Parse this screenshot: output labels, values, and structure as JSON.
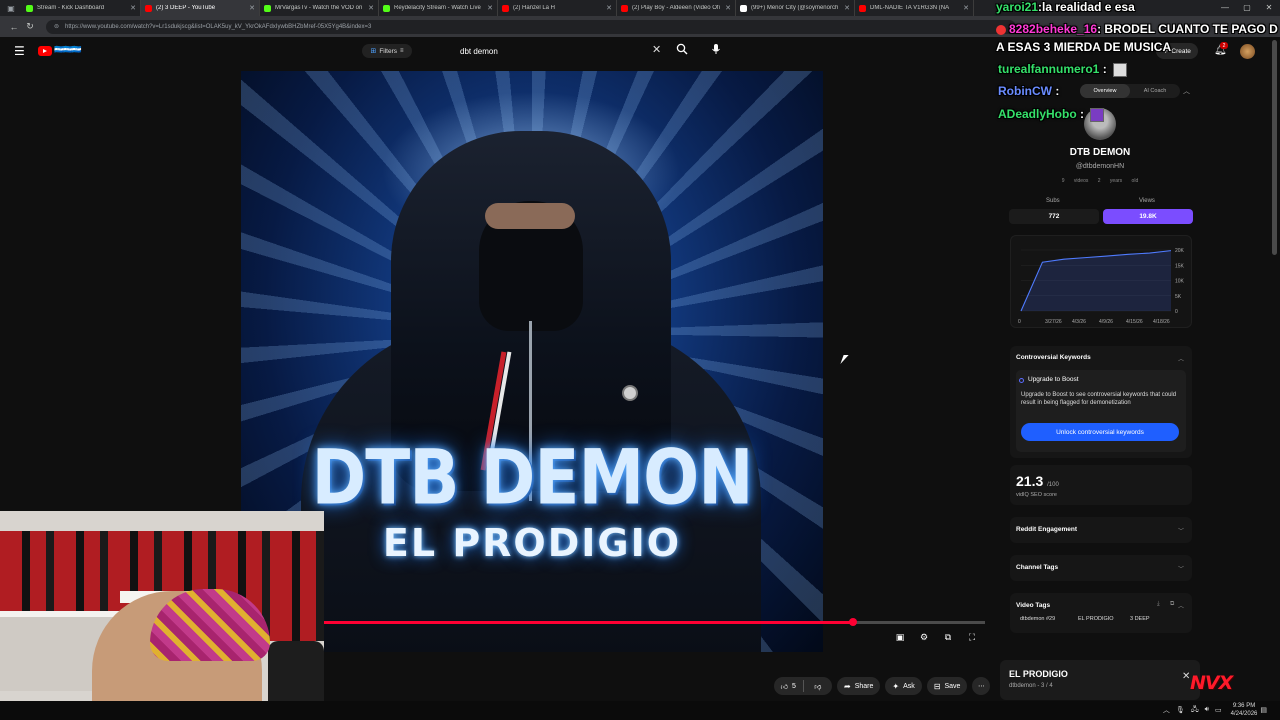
{
  "browser": {
    "tabs": [
      {
        "title": "Stream - Kick Dashboard",
        "favicon_color": "#53fc18"
      },
      {
        "title": "(2) 3 DEEP - YouTube",
        "favicon_color": "#ff0000",
        "active": true
      },
      {
        "title": "MrVargasTv - Watch the VOD on",
        "favicon_color": "#53fc18"
      },
      {
        "title": "Reydelacity Stream - Watch Live",
        "favicon_color": "#53fc18"
      },
      {
        "title": "(2) Hanzel La H",
        "favicon_color": "#ff0000"
      },
      {
        "title": "(2) Play Boy - Aldeeen (Video Ofi",
        "favicon_color": "#ff0000"
      },
      {
        "title": "(99+) Menor City (@soymenorch",
        "favicon_color": "#ffffff"
      },
      {
        "title": "DML-NADIE TA V1RG3N (NA",
        "favicon_color": "#ff0000"
      }
    ],
    "url": "https://www.youtube.com/watch?v=Lr1sdukjscg&list=OLAK5uy_kV_YkrOkAFdxIywbBHZbMref-05X5Yg4B&index=3",
    "window_controls": [
      "—",
      "▢",
      "✕"
    ]
  },
  "youtube": {
    "brand_text": "🇭🇳🇭🇳🇭🇳",
    "filters_label": "Filters",
    "search_query": "dbt demon",
    "create_label": "Create",
    "notification_count": "2"
  },
  "video": {
    "cover_title": "DTB DEMON",
    "cover_subtitle": "EL PRODIGIO",
    "progress": 0.8
  },
  "actions": {
    "like_count": "5",
    "share_label": "Share",
    "ask_label": "Ask",
    "save_label": "Save"
  },
  "vidiq": {
    "tabs": [
      "Overview",
      "AI Coach"
    ],
    "channel_name": "DTB DEMON",
    "channel_handle": "@dtbdemonHN",
    "meta_videos": "9 videos",
    "meta_age": "2 years old",
    "subs_label": "Subs",
    "subs_value": "772",
    "views_label": "Views",
    "views_value": "19.8K",
    "chart_data": {
      "type": "line",
      "x": [
        "3/27/26",
        "4/3/26",
        "4/9/26",
        "4/15/26",
        "4/18/26"
      ],
      "x_start_label": "0",
      "y_ticks": [
        "20K",
        "15K",
        "10K",
        "5K",
        "0"
      ],
      "series": [
        {
          "values": [
            0,
            16000,
            17000,
            17500,
            18000,
            18600,
            19000,
            19800
          ]
        }
      ],
      "ylim": [
        0,
        20000
      ]
    },
    "controversial_title": "Controversial Keywords",
    "boost_title": "Upgrade to Boost",
    "boost_desc": "Upgrade to Boost to see controversial keywords that could result in being flagged for demonetization",
    "boost_button": "Unlock controversial keywords",
    "seo_score": "21.3",
    "seo_of": "/100",
    "seo_label": "vidIQ SEO score",
    "reddit_title": "Reddit Engagement",
    "channel_tags_title": "Channel Tags",
    "video_tags_title": "Video Tags",
    "video_tags": [
      "dtbdemon #29",
      "EL PRODIGIO",
      "3 DEEP"
    ]
  },
  "next_up": {
    "title": "EL PRODIGIO",
    "subtitle": "dtbdemon - 3 / 4"
  },
  "chat": [
    {
      "user": "8282beheke_16",
      "sep": ":",
      "msg": "BRODEL CUANTO TE PAGO D",
      "color": "pink"
    },
    {
      "user": "",
      "sep": "",
      "msg": "A ESAS 3 MIERDA DE MUSICA",
      "color": "pink"
    },
    {
      "user": "turealfannumero1",
      "sep": ":",
      "msg": "",
      "color": "green"
    },
    {
      "user": "RobinCW",
      "sep": ":",
      "msg": "",
      "color": "blue"
    },
    {
      "user": "ADeadlyHobo",
      "sep": ":",
      "msg": "",
      "color": "green"
    },
    {
      "user": "yaroi21",
      "sep": ":",
      "msg": "la realidad e esa",
      "color": "green"
    }
  ],
  "overlay_logo": "NVX",
  "taskbar": {
    "time": "9:36 PM",
    "date": "4/24/2026"
  }
}
